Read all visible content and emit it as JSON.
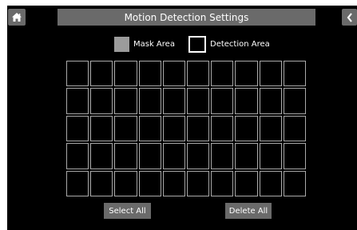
{
  "header": {
    "title": "Motion Detection Settings",
    "home_icon": "home-icon",
    "back_icon": "chevron-left-icon"
  },
  "legend": {
    "mask_label": "Mask Area",
    "detection_label": "Detection Area"
  },
  "grid": {
    "rows": 5,
    "cols": 10,
    "mask_cells": []
  },
  "buttons": {
    "select_all": "Select All",
    "delete_all": "Delete All"
  },
  "colors": {
    "screen_bg": "#000000",
    "bar_bg": "#6a6a6a",
    "mask_fill": "#9b9b9b",
    "grid_line": "#a9a9a9"
  }
}
